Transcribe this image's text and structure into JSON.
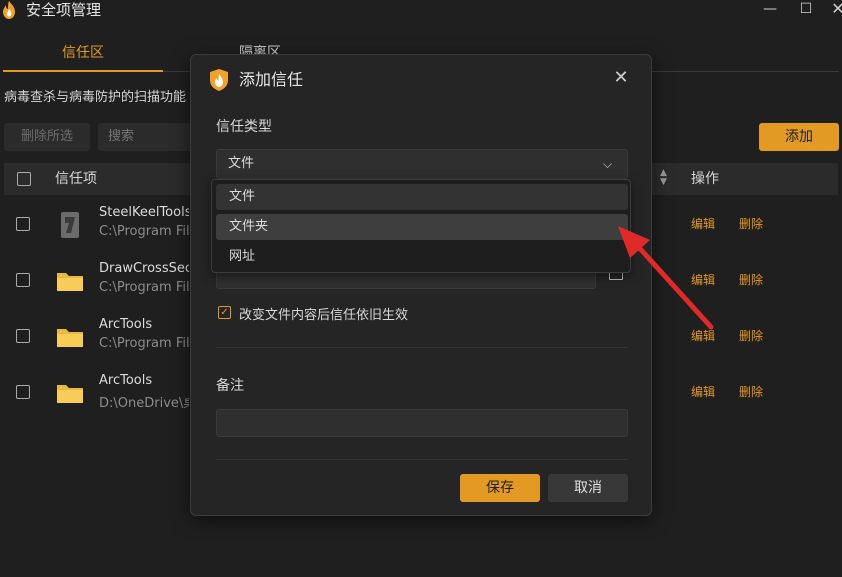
{
  "window": {
    "title": "安全项管理",
    "logo_icon": "flame-shield-icon",
    "controls": {
      "minimize": "—",
      "maximize": "☐",
      "close": "✕"
    }
  },
  "tabs": [
    {
      "label": "信任区",
      "active": true
    },
    {
      "label": "隔离区",
      "active": false
    }
  ],
  "description": "病毒查杀与病毒防护的扫描功能",
  "toolbar": {
    "delete_selected_label": "删除所选",
    "search_placeholder": "搜索",
    "add_label": "添加"
  },
  "table": {
    "headers": {
      "item": "信任项",
      "actions": "操作"
    },
    "rows": [
      {
        "name": "SteelKeelTools",
        "path": "C:\\Program Files",
        "icon": "app-exe-icon",
        "edit": "编辑",
        "delete": "删除"
      },
      {
        "name": "DrawCrossSection",
        "path": "C:\\Program Files",
        "icon": "folder-icon",
        "edit": "编辑",
        "delete": "删除"
      },
      {
        "name": "ArcTools",
        "path": "C:\\Program Files",
        "icon": "folder-icon",
        "edit": "编辑",
        "delete": "删除"
      },
      {
        "name": "ArcTools",
        "path": "D:\\OneDrive\\桌面",
        "icon": "folder-icon",
        "edit": "编辑",
        "delete": "删除"
      }
    ]
  },
  "dialog": {
    "title": "添加信任",
    "type_label": "信任类型",
    "selected_type": "文件",
    "options": [
      "文件",
      "文件夹",
      "网址"
    ],
    "checkbox_label": "改变文件内容后信任依旧生效",
    "checkbox_checked": true,
    "note_label": "备注",
    "save_label": "保存",
    "cancel_label": "取消"
  },
  "colors": {
    "accent": "#e39a25",
    "annotation_arrow": "#e02a2a",
    "background": "#1f1f1f"
  }
}
